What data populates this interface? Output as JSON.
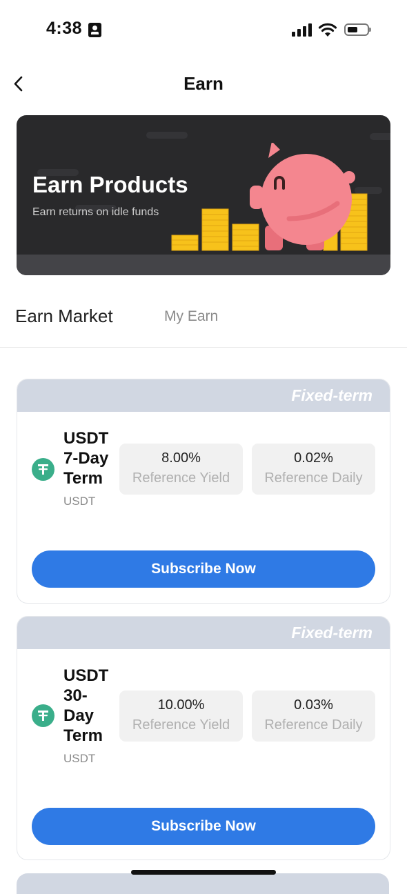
{
  "status_bar": {
    "time": "4:38"
  },
  "header": {
    "title": "Earn"
  },
  "banner": {
    "title": "Earn Products",
    "subtitle": "Earn returns on idle funds",
    "colors": {
      "background": "#29292b",
      "pig": "#f4868f",
      "coins": "#f7c21b"
    }
  },
  "tabs": [
    {
      "label": "Earn Market",
      "active": true
    },
    {
      "label": "My Earn",
      "active": false
    }
  ],
  "products": [
    {
      "tag": "Fixed-term",
      "name_lines": [
        "USDT",
        "7-Day",
        "Term"
      ],
      "asset": "USDT",
      "yield": "8.00%",
      "yield_label": "Reference Yield",
      "daily": "0.02%",
      "daily_label": "Reference Daily",
      "button": "Subscribe Now"
    },
    {
      "tag": "Fixed-term",
      "name_lines": [
        "USDT",
        "30-",
        "Day",
        "Term"
      ],
      "asset": "USDT",
      "yield": "10.00%",
      "yield_label": "Reference Yield",
      "daily": "0.03%",
      "daily_label": "Reference Daily",
      "button": "Subscribe Now"
    }
  ],
  "colors": {
    "accent": "#2f7ae5",
    "card_header": "#d1d7e2",
    "coin": "#3aae8a"
  }
}
